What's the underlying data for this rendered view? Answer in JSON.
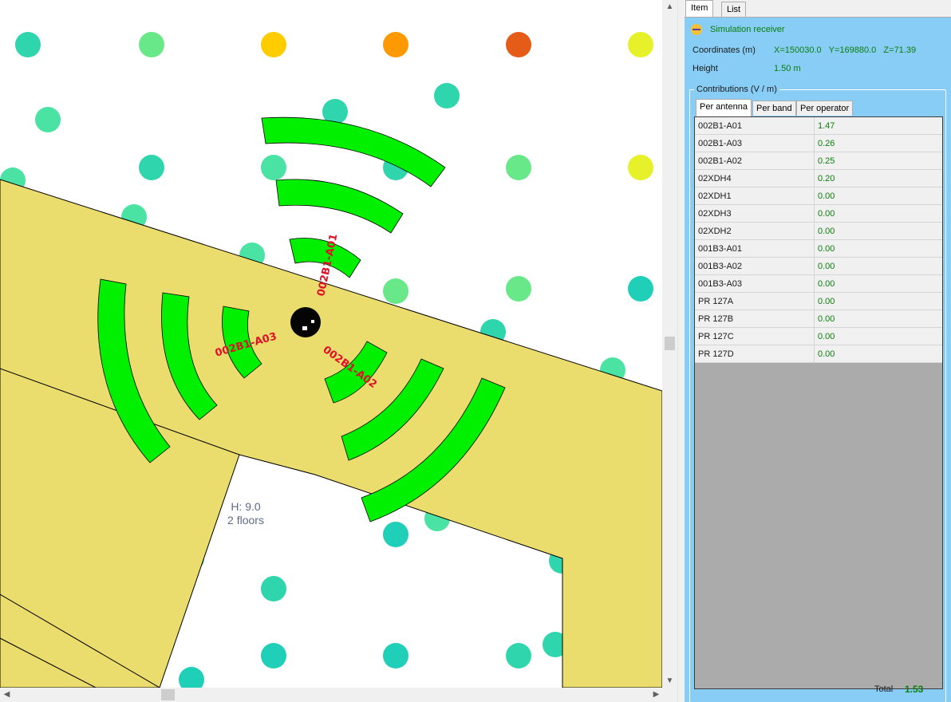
{
  "map": {
    "buildings": [
      {
        "height_label": "H: 9.0",
        "floors_label": "2  floors"
      }
    ],
    "antenna_labels": [
      "002B1-A01",
      "002B1-A03",
      "002B1-A02"
    ],
    "receiver_dots": [
      {
        "color": "#2fd6ad"
      },
      {
        "color": "#68e889"
      },
      {
        "color": "#ffcc00"
      },
      {
        "color": "#ff9900"
      },
      {
        "color": "#e55b18"
      },
      {
        "color": "#e7f12a"
      },
      {
        "color": "#2fd6ad"
      },
      {
        "color": "#4ae3a3"
      },
      {
        "color": "#2fd6ad"
      },
      {
        "color": "#68e889"
      },
      {
        "color": "#e7f12a"
      },
      {
        "color": "#4ae3a3"
      },
      {
        "color": "#4ae3a3"
      },
      {
        "color": "#4ae3a3"
      },
      {
        "color": "#68e889"
      },
      {
        "color": "#1fcfb8"
      },
      {
        "color": "#68e889"
      },
      {
        "color": "#2fd6ad"
      },
      {
        "color": "#4ae3a3"
      },
      {
        "color": "#2fd6ad"
      },
      {
        "color": "#4ae3a3"
      },
      {
        "color": "#2fd6ad"
      },
      {
        "color": "#1fcfb8"
      },
      {
        "color": "#2fd6ad"
      },
      {
        "color": "#1fcfb8"
      },
      {
        "color": "#68e889"
      },
      {
        "color": "#1fcfb8"
      },
      {
        "color": "#4ae3a3"
      },
      {
        "color": "#2fd6ad"
      },
      {
        "color": "#4ae3a3"
      },
      {
        "color": "#2fd6ad"
      },
      {
        "color": "#2fd6ad"
      },
      {
        "color": "#2fd6ad"
      },
      {
        "color": "#1fcfb8"
      },
      {
        "color": "#1fcfb8"
      },
      {
        "color": "#1fcfb8"
      },
      {
        "color": "#2fd6ad"
      },
      {
        "color": "#2fd6ad"
      },
      {
        "color": "#2fd6ad"
      },
      {
        "color": "#2fd6ad"
      },
      {
        "color": "#2fd6ad"
      },
      {
        "color": "#1fcfb8"
      },
      {
        "color": "#2fd6ad"
      },
      {
        "color": "#1fcfb8"
      },
      {
        "color": "#2fd6ad"
      },
      {
        "color": "#2fd6ad"
      },
      {
        "color": "#2fd6ad"
      },
      {
        "color": "#2fd6ad"
      },
      {
        "color": "#4ae3a3"
      },
      {
        "color": "#4ae3a3"
      },
      {
        "color": "#2fd6ad"
      },
      {
        "color": "#2fd6ad"
      }
    ],
    "colors": {
      "building": "#ebdc6e",
      "sector": "#00f000",
      "label": "#e0102a",
      "background": "#ffffff"
    }
  },
  "panel": {
    "tabs": [
      {
        "label": "Item"
      },
      {
        "label": "List"
      }
    ],
    "receiver_title": "Simulation receiver",
    "receiver_icon": "receiver-icon",
    "coordinates_label": "Coordinates (m)",
    "coordinates_value": "X=150030.0   Y=169880.0   Z=71.39",
    "height_label": "Height",
    "height_value": "1.50 m",
    "contributions_title": "Contributions (V / m)",
    "sub_tabs": [
      {
        "label": "Per antenna"
      },
      {
        "label": "Per band"
      },
      {
        "label": "Per operator"
      }
    ],
    "rows": [
      {
        "name": "002B1-A01",
        "value": "1.47"
      },
      {
        "name": "002B1-A03",
        "value": "0.26"
      },
      {
        "name": "002B1-A02",
        "value": "0.25"
      },
      {
        "name": "02XDH4",
        "value": "0.20"
      },
      {
        "name": "02XDH1",
        "value": "0.00"
      },
      {
        "name": "02XDH3",
        "value": "0.00"
      },
      {
        "name": "02XDH2",
        "value": "0.00"
      },
      {
        "name": "001B3-A01",
        "value": "0.00"
      },
      {
        "name": "001B3-A02",
        "value": "0.00"
      },
      {
        "name": "001B3-A03",
        "value": "0.00"
      },
      {
        "name": "PR 127A",
        "value": "0.00"
      },
      {
        "name": "PR 127B",
        "value": "0.00"
      },
      {
        "name": "PR 127C",
        "value": "0.00"
      },
      {
        "name": "PR 127D",
        "value": "0.00"
      }
    ],
    "total_label": "Total",
    "total_value": "1.53"
  }
}
